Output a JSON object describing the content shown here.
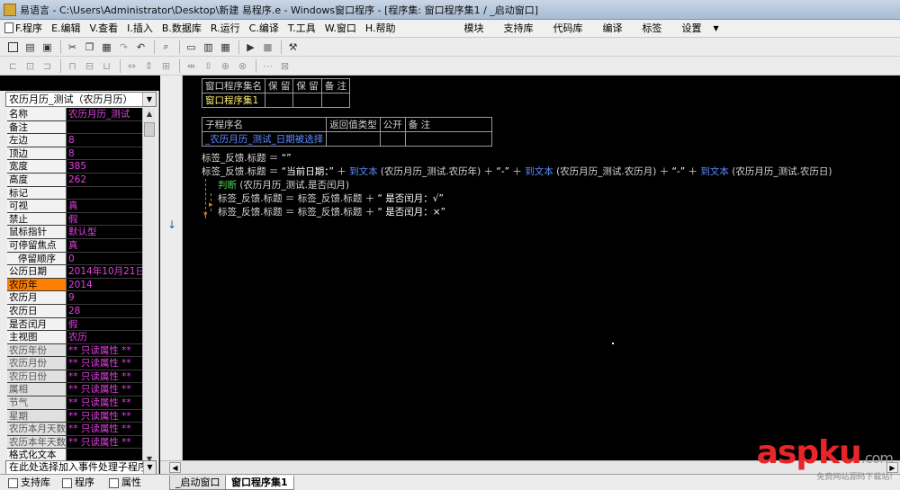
{
  "window": {
    "title": "易语言 - C:\\Users\\Administrator\\Desktop\\新建 易程序.e - Windows窗口程序 - [程序集: 窗口程序集1 / _启动窗口]"
  },
  "menu": {
    "items": [
      "F.程序",
      "E.编辑",
      "V.查看",
      "I.插入",
      "B.数据库",
      "R.运行",
      "C.编译",
      "T.工具",
      "W.窗口",
      "H.帮助"
    ],
    "right_items": [
      "模块",
      "支持库",
      "代码库",
      "编译",
      "标签",
      "设置"
    ],
    "settings_arrow": "▼"
  },
  "left_panel": {
    "object_selector": "农历月历_测试（农历月历）",
    "properties": [
      {
        "name": "名称",
        "value": "农历月历_测试"
      },
      {
        "name": "备注",
        "value": ""
      },
      {
        "name": "左边",
        "value": "8"
      },
      {
        "name": "顶边",
        "value": "8"
      },
      {
        "name": "宽度",
        "value": "385"
      },
      {
        "name": "高度",
        "value": "262"
      },
      {
        "name": "标记",
        "value": ""
      },
      {
        "name": "可视",
        "value": "真"
      },
      {
        "name": "禁止",
        "value": "假"
      },
      {
        "name": "鼠标指针",
        "value": "默认型"
      },
      {
        "name": "可停留焦点",
        "value": "真"
      },
      {
        "name": "停留顺序",
        "value": "0"
      },
      {
        "name": "公历日期",
        "value": "2014年10月21日23"
      },
      {
        "name": "农历年",
        "value": "2014"
      },
      {
        "name": "农历月",
        "value": "9"
      },
      {
        "name": "农历日",
        "value": "28"
      },
      {
        "name": "是否闰月",
        "value": "假"
      },
      {
        "name": "主视图",
        "value": "农历"
      },
      {
        "name": "农历年份",
        "value": "** 只读属性 **"
      },
      {
        "name": "农历月份",
        "value": "** 只读属性 **"
      },
      {
        "name": "农历日份",
        "value": "** 只读属性 **"
      },
      {
        "name": "属相",
        "value": "** 只读属性 **"
      },
      {
        "name": "节气",
        "value": "** 只读属性 **"
      },
      {
        "name": "星期",
        "value": "** 只读属性 **"
      },
      {
        "name": "农历本月天数",
        "value": "** 只读属性 **"
      },
      {
        "name": "农历本年天数",
        "value": "** 只读属性 **"
      },
      {
        "name": "格式化文本",
        "value": ""
      }
    ],
    "event_hint": "在此处选择加入事件处理子程序",
    "tabs": [
      "支持库",
      "程序",
      "属性"
    ]
  },
  "editor": {
    "assembly_table": {
      "headers": [
        "窗口程序集名",
        "保 留",
        "保 留",
        "备 注"
      ],
      "row": [
        "窗口程序集1",
        "",
        "",
        ""
      ]
    },
    "sub_table": {
      "headers": [
        "子程序名",
        "返回值类型",
        "公开",
        "备 注"
      ],
      "row": [
        "_农历月历_测试_日期被选择",
        "",
        "",
        ""
      ]
    },
    "code": {
      "line1_a": "标签_反馈.标题 ＝ ",
      "line1_b": "“”",
      "line2_a": "标签_反馈.标题 ＝ ",
      "line2_b": "“当前日期：”",
      "line2_c": " ＋ ",
      "line2_d": "到文本",
      "line2_e": " (农历月历_测试.农历年) ＋ ",
      "line2_f": "“-”",
      "line2_g": " ＋ ",
      "line2_h": "到文本",
      "line2_i": " (农历月历_测试.农历月) ＋ ",
      "line2_j": "“-”",
      "line2_k": " ＋ ",
      "line2_l": "到文本",
      "line2_m": " (农历月历_测试.农历日)",
      "line3_kw": "判断",
      "line3_rest": " (农历月历_测试.是否闰月)",
      "line4_a": "标签_反馈.标题 ＝ 标签_反馈.标题 ＋ ",
      "line4_b": "“  是否闰月：√”",
      "line5_a": "标签_反馈.标题 ＝ 标签_反馈.标题 ＋ ",
      "line5_b": "“  是否闰月：×”"
    },
    "tabs": [
      "_启动窗口",
      "窗口程序集1"
    ]
  },
  "watermark": {
    "logo": "aspku",
    "suffix": ".com",
    "subtitle": "免费网站源码下载站!"
  }
}
